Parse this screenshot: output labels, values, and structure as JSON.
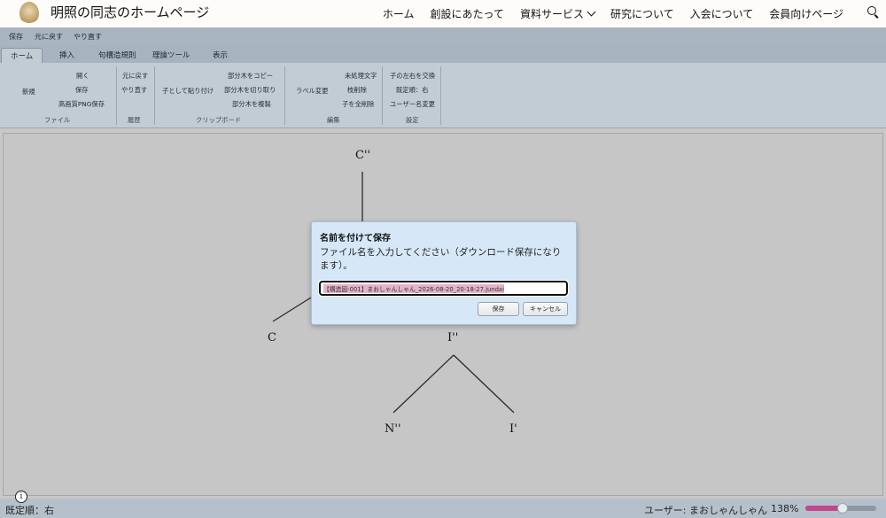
{
  "site": {
    "title": "明照の同志のホームページ",
    "nav": [
      "ホーム",
      "創設にあたって",
      "資料サービス",
      "研究について",
      "入会について",
      "会員向けページ"
    ]
  },
  "quickbar": {
    "save": "保存",
    "undo": "元に戻す",
    "redo": "やり直す"
  },
  "tabs": [
    {
      "label": "ホーム",
      "active": true
    },
    {
      "label": "挿入"
    },
    {
      "label": "句構造規則"
    },
    {
      "label": "理論ツール"
    },
    {
      "label": "表示"
    }
  ],
  "ribbon": {
    "file": {
      "new": "新規",
      "open": "開く",
      "save": "保存",
      "png": "高画質PNG保存",
      "group": "ファイル"
    },
    "history": {
      "undo": "元に戻す",
      "redo": "やり直す",
      "group": "履歴"
    },
    "clipboard": {
      "paste_child": "子として貼り付け",
      "copy": "部分木をコピー",
      "cut": "部分木を切り取り",
      "dup": "部分木を複製",
      "group": "クリップボード"
    },
    "edit": {
      "rename": "ラベル変更",
      "tex": "未処理文字",
      "remove_node": "枝削除",
      "remove_children": "子を全削除",
      "group": "編集"
    },
    "settings": {
      "swap": "子の左右を交換",
      "head": "既定順：右",
      "username": "ユーザー名変更",
      "group": "設定"
    }
  },
  "tree": {
    "nodes": [
      "C''",
      "C",
      "I''",
      "N''",
      "I'"
    ]
  },
  "dialog": {
    "title": "名前を付けて保存",
    "message": "ファイル名を入力してください（ダウンロード保存になります）。",
    "filename": "【構造図-001】まおしゃんしゃん_2026-08-20_20-18-27.jundai",
    "ok": "保存",
    "cancel": "キャンセル"
  },
  "status": {
    "order": "既定順：右",
    "user": "ユーザー: まおしゃんしゃん",
    "zoom": "138%",
    "zoom_level": 0.53
  },
  "colors": {
    "accent": "#c2478a",
    "dialog_bg": "#d6e8f8",
    "ribbon_bg": "#c2ccd5"
  }
}
